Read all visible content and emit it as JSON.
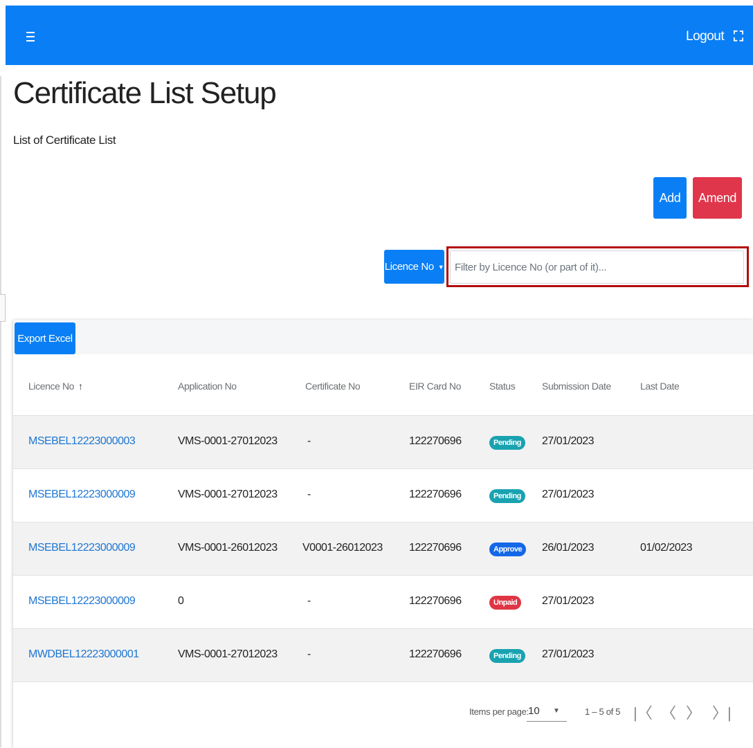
{
  "header": {
    "menu_icon": "hamburger-icon",
    "logout_label": "Logout",
    "fullscreen_icon": "fullscreen-toggle-icon",
    "fullscreen_glyph": "⛶",
    "brand_color": "#0a7ff5"
  },
  "page": {
    "title": "Certificate List Setup",
    "subtitle": "List of Certificate List"
  },
  "actions": {
    "add_label": "Add",
    "amend_label": "Amend",
    "amend_color": "#e0364b"
  },
  "filter": {
    "field_label": "Licence No",
    "caret": "▼",
    "placeholder": "Filter by Licence No (or part of it)...",
    "value": ""
  },
  "table": {
    "export_label": "Export Excel",
    "sort_icon": "↑",
    "columns": [
      "Licence No",
      "Application No",
      "Certificate No",
      "EIR Card No",
      "Status",
      "Submission Date",
      "Last Date"
    ],
    "rows": [
      {
        "licence_no": "MSEBEL12223000003",
        "application_no": "VMS-0001-27012023",
        "certificate_no": "-",
        "eir_card_no": "122270696",
        "status": "Pending",
        "submission_date": "27/01/2023",
        "last_date": ""
      },
      {
        "licence_no": "MSEBEL12223000009",
        "application_no": "VMS-0001-27012023",
        "certificate_no": "-",
        "eir_card_no": "122270696",
        "status": "Pending",
        "submission_date": "27/01/2023",
        "last_date": ""
      },
      {
        "licence_no": "MSEBEL12223000009",
        "application_no": "VMS-0001-26012023",
        "certificate_no": "V0001-26012023",
        "eir_card_no": "122270696",
        "status": "Approve",
        "submission_date": "26/01/2023",
        "last_date": "01/02/2023"
      },
      {
        "licence_no": "MSEBEL12223000009",
        "application_no": "0",
        "certificate_no": "-",
        "eir_card_no": "122270696",
        "status": "Unpaid",
        "submission_date": "27/01/2023",
        "last_date": ""
      },
      {
        "licence_no": "MWDBEL12223000001",
        "application_no": "VMS-0001-27012023",
        "certificate_no": "-",
        "eir_card_no": "122270696",
        "status": "Pending",
        "submission_date": "27/01/2023",
        "last_date": ""
      }
    ],
    "status_colors": {
      "Pending": "#19a2b0",
      "Approve": "#1468e8",
      "Unpaid": "#df3545"
    }
  },
  "paginator": {
    "items_per_page_label": "Items per page:",
    "items_per_page_value": "10",
    "caret": "▼",
    "range_label": "1 – 5 of 5",
    "first_icon": "|〈",
    "prev_icon": "〈",
    "next_icon": "〉",
    "last_icon": "〉|"
  }
}
